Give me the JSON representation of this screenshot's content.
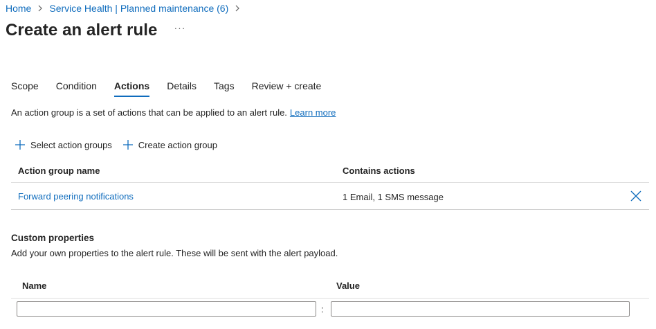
{
  "breadcrumb": {
    "items": [
      "Home",
      "Service Health | Planned maintenance (6)"
    ]
  },
  "page": {
    "title": "Create an alert rule",
    "more": "···"
  },
  "tabs": [
    {
      "label": "Scope"
    },
    {
      "label": "Condition"
    },
    {
      "label": "Actions",
      "active": true
    },
    {
      "label": "Details"
    },
    {
      "label": "Tags"
    },
    {
      "label": "Review + create"
    }
  ],
  "intro": {
    "text": "An action group is a set of actions that can be applied to an alert rule.",
    "link": "Learn more"
  },
  "commands": {
    "select": "Select action groups",
    "create": "Create action group"
  },
  "action_groups": {
    "headers": {
      "name": "Action group name",
      "actions": "Contains actions"
    },
    "rows": [
      {
        "name": "Forward peering notifications",
        "actions": "1 Email, 1 SMS message"
      }
    ]
  },
  "custom_properties": {
    "title": "Custom properties",
    "description": "Add your own properties to the alert rule. These will be sent with the alert payload.",
    "headers": {
      "name": "Name",
      "value": "Value"
    },
    "row": {
      "name_value": "",
      "value_value": "",
      "separator": ":"
    }
  },
  "colors": {
    "accent": "#0f6cbd",
    "text": "#242424"
  }
}
